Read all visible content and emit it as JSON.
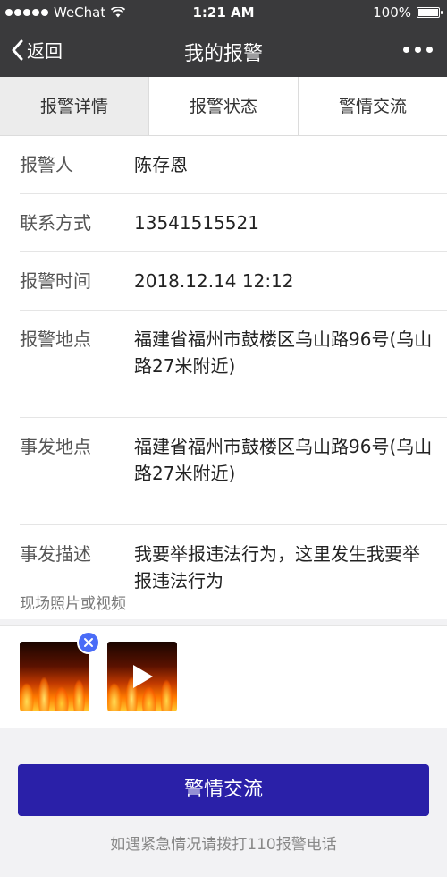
{
  "status_bar": {
    "carrier": "WeChat",
    "time": "1:21 AM",
    "battery": "100%"
  },
  "nav": {
    "back_label": "返回",
    "title": "我的报警"
  },
  "tabs": [
    {
      "label": "报警详情"
    },
    {
      "label": "报警状态"
    },
    {
      "label": "警情交流"
    }
  ],
  "details": [
    {
      "label": "报警人",
      "value": "陈存恩"
    },
    {
      "label": "联系方式",
      "value": "13541515521"
    },
    {
      "label": "报警时间",
      "value": "2018.12.14 12:12"
    },
    {
      "label": "报警地点",
      "value": "福建省福州市鼓楼区乌山路96号(乌山路27米附近)"
    },
    {
      "label": "事发地点",
      "value": "福建省福州市鼓楼区乌山路96号(乌山路27米附近)"
    },
    {
      "label": "事发描述",
      "value": "我要举报违法行为，这里发生我要举报违法行为"
    }
  ],
  "media": {
    "caption": "现场照片或视频"
  },
  "primary_button": "警情交流",
  "footer_note": "如遇紧急情况请拨打110报警电话",
  "colors": {
    "bar_bg": "#3a3a3c",
    "primary": "#2a20a8",
    "badge": "#4a6cf7"
  }
}
